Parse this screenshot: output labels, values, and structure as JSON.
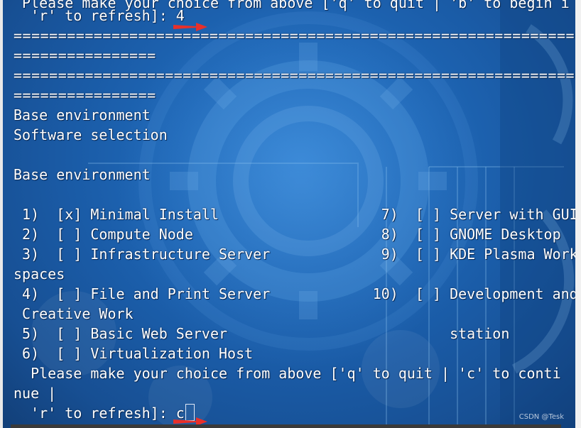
{
  "terminal": {
    "lines": {
      "l00": " Please make your choice from above ['q' to quit | 'b' to begin i",
      "l01": "  'r' to refresh]: 4",
      "l02": "================================================================",
      "l03": "================",
      "l04": "================================================================",
      "l05": "================",
      "l06": "Base environment",
      "l07": "Software selection",
      "l09": "Base environment",
      "l11": " 1)  [x] Minimal Install                   7)  [ ] Server with GUI",
      "l12": " 2)  [ ] Compute Node                      8)  [ ] GNOME Desktop",
      "l13": " 3)  [ ] Infrastructure Server             9)  [ ] KDE Plasma Work",
      "l14": "spaces",
      "l15": " 4)  [ ] File and Print Server            10)  [ ] Development and",
      "l16": " Creative Work",
      "l17": " 5)  [ ] Basic Web Server                          station",
      "l18": " 6)  [ ] Virtualization Host",
      "l19": "  Please make your choice from above ['q' to quit | 'c' to conti",
      "l20": "nue |",
      "l21": "  'r' to refresh]: c"
    }
  },
  "watermark": "CSDN @Tesk",
  "colors": {
    "text": "#ffffff",
    "arrow": "#e8302a",
    "background": "#1f68b8"
  }
}
